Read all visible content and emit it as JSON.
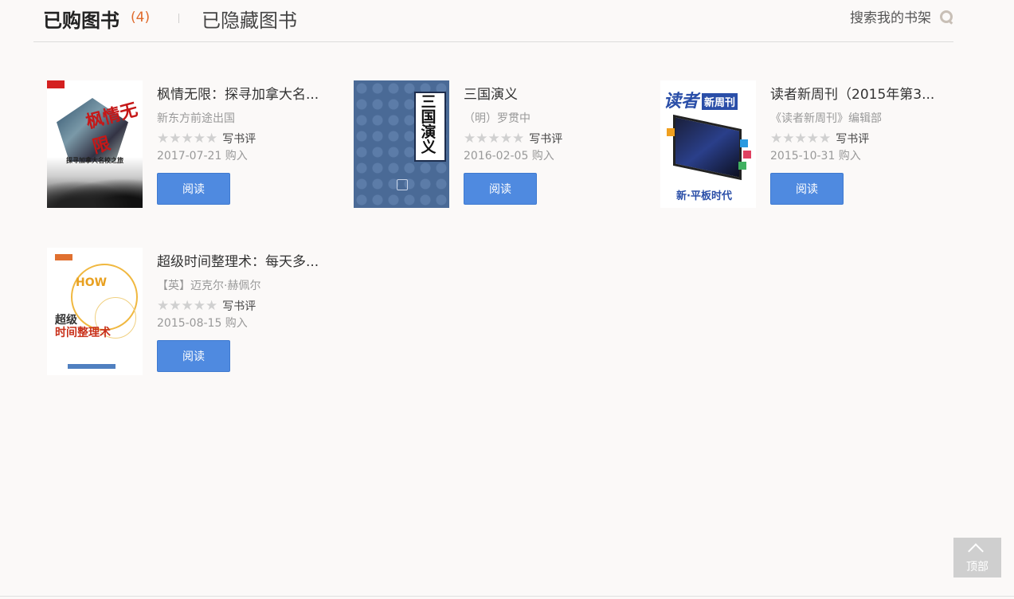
{
  "header": {
    "tab_purchased": "已购图书",
    "purchased_count": "(4)",
    "tab_hidden": "已隐藏图书",
    "search_label": "搜索我的书架"
  },
  "books": [
    {
      "title": "枫情无限：探寻加拿大名...",
      "author": "新东方前途出国",
      "rating_stars": "★★★★★",
      "rating_value": 0,
      "review_label": "写书评",
      "purchase_date": "2017-07-21 购入",
      "read_label": "阅读",
      "cover": {
        "art_title": "枫情无限",
        "art_subtitle": "探寻加拿大名校之旅"
      }
    },
    {
      "title": "三国演义",
      "author": "（明）罗贯中",
      "rating_stars": "★★★★★",
      "rating_value": 0,
      "review_label": "写书评",
      "purchase_date": "2016-02-05 购入",
      "read_label": "阅读",
      "cover": {
        "art_title": "三国演义"
      }
    },
    {
      "title": "读者新周刊（2015年第3...",
      "author": "《读者新周刊》编辑部",
      "rating_stars": "★★★★★",
      "rating_value": 0,
      "review_label": "写书评",
      "purchase_date": "2015-10-31 购入",
      "read_label": "阅读",
      "cover": {
        "art_title": "读者",
        "art_badge": "新周刊",
        "art_bottom": "新·平板时代"
      }
    },
    {
      "title": "超级时间整理术：每天多...",
      "author": "【英】迈克尔·赫佩尔",
      "rating_stars": "★★★★★",
      "rating_value": 0,
      "review_label": "写书评",
      "purchase_date": "2015-08-15 购入",
      "read_label": "阅读",
      "cover": {
        "art_top": "HOW",
        "art_line1": "超级",
        "art_line2": "时间整理术"
      }
    }
  ],
  "back_to_top": {
    "label": "顶部"
  },
  "colors": {
    "accent_button": "#4f8ae0",
    "count_orange": "#e06a2b",
    "star_gray": "#d0d0d0",
    "background": "#fbf9f8"
  },
  "icons": [
    "search-icon",
    "chevron-up-icon"
  ]
}
